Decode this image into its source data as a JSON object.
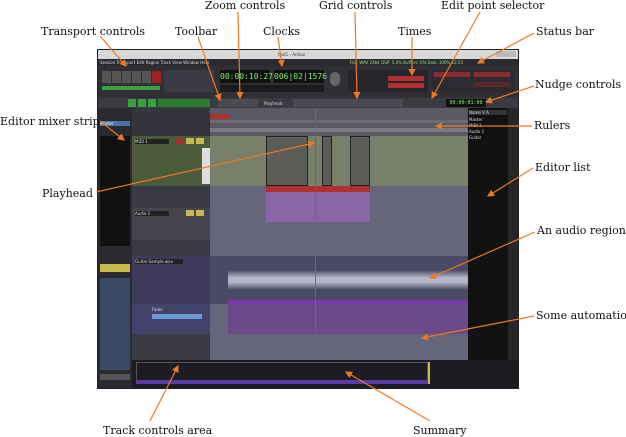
{
  "labels": {
    "zoom_controls": "Zoom controls",
    "grid_controls": "Grid controls",
    "edit_point_selector": "Edit point selector",
    "transport_controls": "Transport controls",
    "toolbar": "Toolbar",
    "clocks": "Clocks",
    "times": "Times",
    "status_bar": "Status bar",
    "nudge_controls": "Nudge controls",
    "editor_mixer_strip": "Editor mixer strip",
    "rulers": "Rulers",
    "editor_list": "Editor list",
    "playhead": "Playhead",
    "audio_region": "An audio region",
    "automation": "Some automation",
    "track_controls_area": "Track controls area",
    "summary": "Summary"
  },
  "app": {
    "window_title": "test1 - Ardour",
    "menu": [
      "Session",
      "Transport",
      "Edit",
      "Region",
      "Track",
      "View",
      "Window",
      "Help"
    ],
    "primary_clock": "00:00:10:27",
    "secondary_clock": "006|02|1576",
    "status_text": "File: WAV 24bit  DSP: 5.0%  Buffers: 0%  Disk: 100%  12:55",
    "nudge_clock": "00:00:01:00",
    "edit_point": "Playhead",
    "tracks": [
      {
        "name": "MIDI 1",
        "type": "midi"
      },
      {
        "name": "Audio 1",
        "type": "audio"
      },
      {
        "name": "Guitar-Sample.wav",
        "type": "audio"
      }
    ],
    "automation_label": "Fader",
    "editor_list_header": [
      "Name",
      "V",
      "A"
    ],
    "editor_list_rows": [
      "Master",
      "MIDI 1",
      "Audio 1",
      "Guitar"
    ],
    "mixer_strip_name": "Master"
  }
}
